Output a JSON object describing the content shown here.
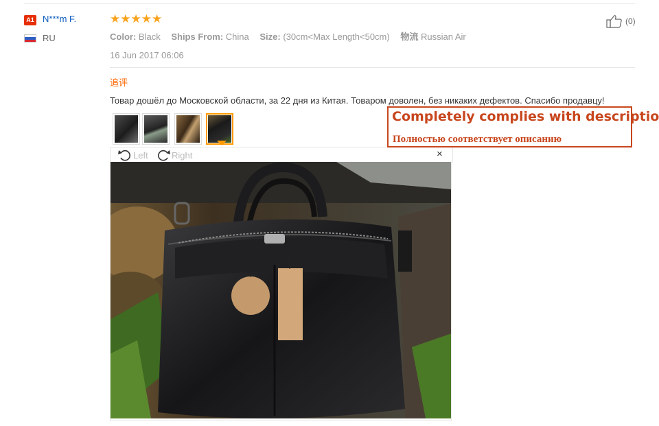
{
  "user": {
    "badge": "A1",
    "name": "N***m F.",
    "country": "RU"
  },
  "review": {
    "stars": "★★★★★",
    "attributes": [
      {
        "key": "Color:",
        "value": "Black"
      },
      {
        "key": "Ships From:",
        "value": "China"
      },
      {
        "key": "Size:",
        "value": "(30cm<Max Length<50cm)"
      },
      {
        "key": "物流",
        "value": "Russian Air"
      }
    ],
    "date": "16 Jun 2017 06:06",
    "additional_label": "追评",
    "text": "Товар дошёл до Московской области, за 22 дня из Китая. Товаром доволен, без никаких дефектов. Спасибо продавцу!",
    "helpful_count": "(0)",
    "thumbnails_count": 4,
    "active_thumbnail": 4
  },
  "viewer": {
    "rotate_left": "Left",
    "rotate_right": "Right",
    "close": "×"
  },
  "annotation": {
    "english": "Completely complies with description",
    "russian": "Полностью соответствует описанию"
  },
  "colors": {
    "badge": "#e62e04",
    "username": "#0b5bbf",
    "stars": "#f9a21b",
    "additional": "#ff6600",
    "annotation": "#c8461d",
    "thumb_active": "#ff9900"
  }
}
